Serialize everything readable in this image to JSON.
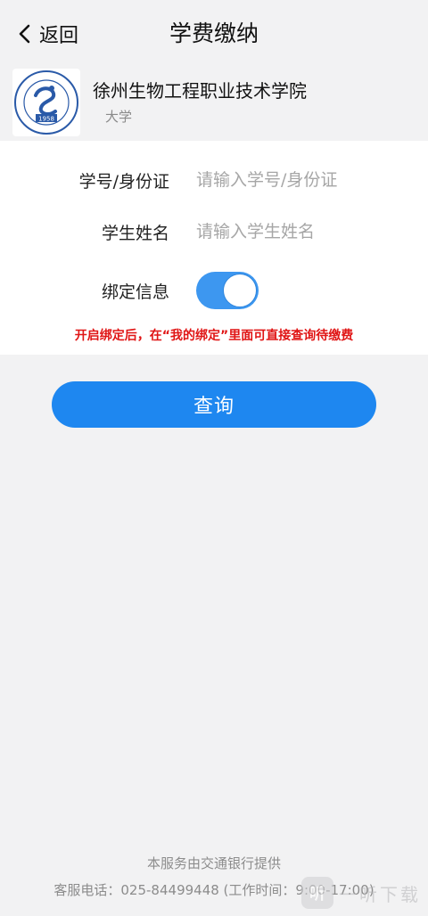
{
  "header": {
    "back_label": "返回",
    "title": "学费缴纳"
  },
  "school": {
    "name": "徐州生物工程职业技术学院",
    "type": "大学",
    "logo_year": "1958"
  },
  "form": {
    "student_id": {
      "label": "学号/身份证",
      "value": "",
      "placeholder": "请输入学号/身份证"
    },
    "student_name": {
      "label": "学生姓名",
      "value": "",
      "placeholder": "请输入学生姓名"
    },
    "bind": {
      "label": "绑定信息",
      "enabled": true
    },
    "hint": "开启绑定后，在“我的绑定”里面可直接查询待缴费"
  },
  "actions": {
    "query_label": "查询"
  },
  "footer": {
    "provider": "本服务由交通银行提供",
    "hotline": "客服电话：025-84499448 (工作时间：9:00-17:00)"
  },
  "watermark": {
    "text": "一听下载"
  },
  "colors": {
    "primary": "#1e87f0",
    "toggle_on": "#3d97f0",
    "hint_red": "#e01515",
    "background": "#f2f2f3"
  }
}
